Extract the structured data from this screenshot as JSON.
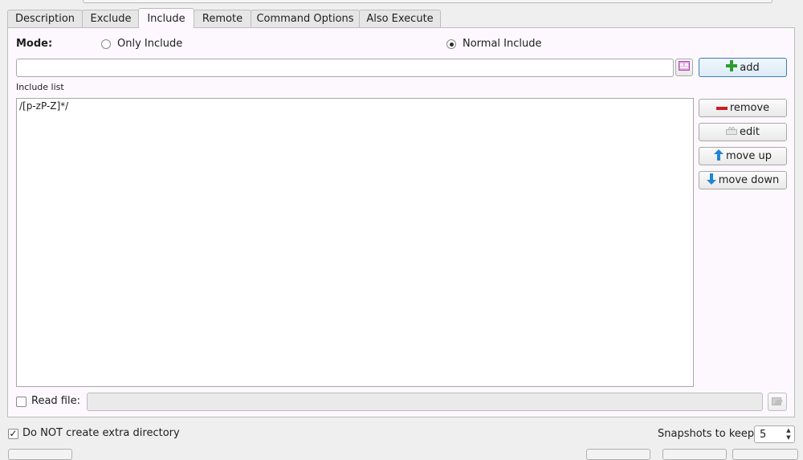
{
  "tabs": [
    {
      "label": "Description"
    },
    {
      "label": "Exclude"
    },
    {
      "label": "Include"
    },
    {
      "label": "Remote"
    },
    {
      "label": "Command Options"
    },
    {
      "label": "Also Execute"
    }
  ],
  "active_tab": "Include",
  "mode": {
    "label": "Mode:",
    "options": [
      "Only Include",
      "Normal Include"
    ],
    "selected": "Normal Include"
  },
  "add_input": {
    "value": ""
  },
  "buttons": {
    "add": "add",
    "remove": "remove",
    "edit": "edit",
    "move_up": "move up",
    "move_down": "move down"
  },
  "include_list": {
    "label": "Include list",
    "items": [
      "/[p-zP-Z]*/"
    ]
  },
  "read_file": {
    "label": "Read file:",
    "checked": false,
    "value": ""
  },
  "no_extra_dir": {
    "label": "Do NOT create extra directory",
    "checked": true
  },
  "snapshots": {
    "label": "Snapshots to keep:",
    "value": "5"
  },
  "icons": {
    "add": "plus-icon",
    "remove": "minus-icon",
    "edit": "edit-icon",
    "up": "arrow-up-icon",
    "down": "arrow-down-icon",
    "picker": "file-picker-icon",
    "read_file_btn": "open-file-icon"
  },
  "colors": {
    "accent": "#3d7eb5",
    "panel": "#fcf8fd",
    "plus": "#2e9d2e",
    "minus": "#cc1f1f",
    "arrow": "#1f86d6"
  }
}
